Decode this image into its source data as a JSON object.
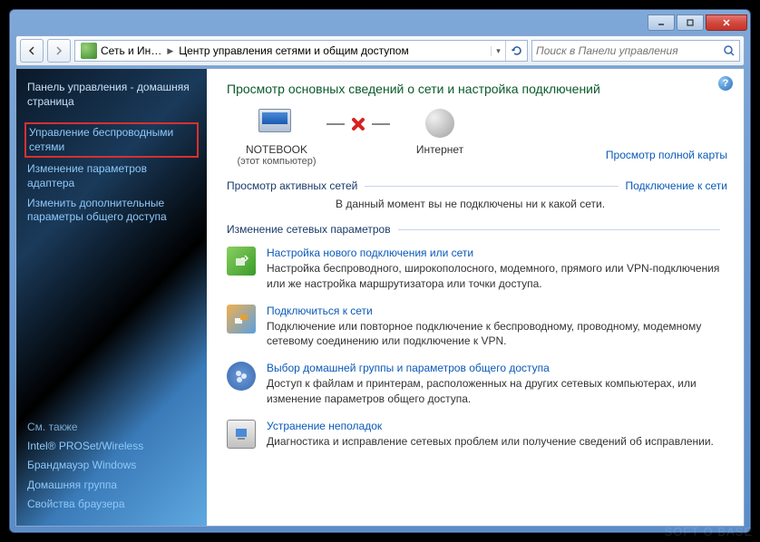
{
  "titlebar": {
    "minimize": "–",
    "maximize": "□",
    "close": "×"
  },
  "address": {
    "seg1": "Сеть и Ин…",
    "seg2": "Центр управления сетями и общим доступом"
  },
  "search": {
    "placeholder": "Поиск в Панели управления"
  },
  "sidebar": {
    "home": "Панель управления - домашняя страница",
    "wireless": "Управление беспроводными сетями",
    "adapter": "Изменение параметров адаптера",
    "sharing": "Изменить дополнительные параметры общего доступа",
    "see_also": "См. также",
    "link1": "Intel® PROSet/Wireless",
    "link2": "Брандмауэр Windows",
    "link3": "Домашняя группа",
    "link4": "Свойства браузера"
  },
  "main": {
    "title": "Просмотр основных сведений о сети и настройка подключений",
    "map_link": "Просмотр полной карты",
    "node1": "NOTEBOOK",
    "node1_sub": "(этот компьютер)",
    "node2": "Интернет",
    "active_head": "Просмотр активных сетей",
    "active_link": "Подключение к сети",
    "active_text": "В данный момент вы не подключены ни к какой сети.",
    "change_head": "Изменение сетевых параметров",
    "tasks": [
      {
        "title": "Настройка нового подключения или сети",
        "desc": "Настройка беспроводного, широкополосного, модемного, прямого или VPN-подключения или же настройка маршрутизатора или точки доступа."
      },
      {
        "title": "Подключиться к сети",
        "desc": "Подключение или повторное подключение к беспроводному, проводному, модемному сетевому соединению или подключение к VPN."
      },
      {
        "title": "Выбор домашней группы и параметров общего доступа",
        "desc": "Доступ к файлам и принтерам, расположенных на других сетевых компьютерах, или изменение параметров общего доступа."
      },
      {
        "title": "Устранение неполадок",
        "desc": "Диагностика и исправление сетевых проблем или получение сведений об исправлении."
      }
    ]
  },
  "watermark": "SOFT O BASE"
}
